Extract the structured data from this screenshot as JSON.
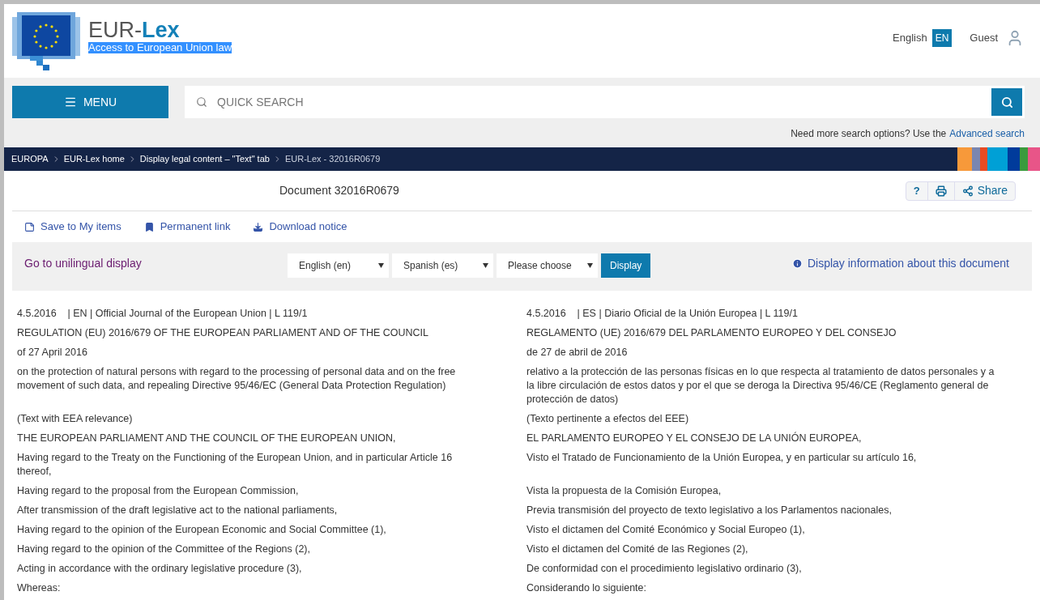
{
  "header": {
    "logo_text": "EUR-",
    "logo_bold": "Lex",
    "tagline": "Access to European Union law",
    "language": "English",
    "language_code": "EN",
    "user": "Guest"
  },
  "search": {
    "menu_label": "MENU",
    "placeholder": "QUICK SEARCH",
    "more_options": "Need more search options? Use the",
    "advanced_link": "Advanced search"
  },
  "breadcrumb": [
    "EUROPA",
    "EUR-Lex home",
    "Display legal content – \"Text\" tab",
    "EUR-Lex - 32016R0679"
  ],
  "document": {
    "title": "Document 32016R0679",
    "tools": [
      {
        "kind": "help",
        "label": "?"
      },
      {
        "kind": "print"
      },
      {
        "kind": "share",
        "label": "Share"
      }
    ]
  },
  "actions": [
    {
      "kind": "save",
      "label": "Save to My items"
    },
    {
      "kind": "bookmark",
      "label": "Permanent link"
    },
    {
      "kind": "download",
      "label": "Download notice"
    }
  ],
  "display_bar": {
    "unilingual_link": "Go to unilingual display",
    "selects": [
      "English (en)",
      "Spanish (es)",
      "Please choose"
    ],
    "display_button": "Display",
    "info_link": "Display information about this document"
  },
  "rows": [
    {
      "en": "4.5.2016    | EN | Official Journal of the European Union | L 119/1",
      "es": "4.5.2016    | ES | Diario Oficial de la Unión Europea | L 119/1"
    },
    {
      "en": "REGULATION (EU) 2016/679 OF THE EUROPEAN PARLIAMENT AND OF THE COUNCIL",
      "es": "REGLAMENTO (UE) 2016/679 DEL PARLAMENTO EUROPEO Y DEL CONSEJO"
    },
    {
      "en": "of 27 April 2016",
      "es": "de 27 de abril de 2016"
    },
    {
      "en": "on the protection of natural persons with regard to the processing of personal data and on the free movement of such data, and repealing Directive 95/46/EC (General Data Protection Regulation)",
      "es": "relativo a la protección de las personas físicas en lo que respecta al tratamiento de datos personales y a la libre circulación de estos datos y por el que se deroga la Directiva 95/46/CE (Reglamento general de protección de datos)"
    },
    {
      "en": "(Text with EEA relevance)",
      "es": "(Texto pertinente a efectos del EEE)"
    },
    {
      "en": "THE EUROPEAN PARLIAMENT AND THE COUNCIL OF THE EUROPEAN UNION,",
      "es": "EL PARLAMENTO EUROPEO Y EL CONSEJO DE LA UNIÓN EUROPEA,"
    },
    {
      "en": "Having regard to the Treaty on the Functioning of the European Union, and in particular Article 16 thereof,",
      "es": "Visto el Tratado de Funcionamiento de la Unión Europea, y en particular su artículo 16,"
    },
    {
      "en": "Having regard to the proposal from the European Commission,",
      "es": "Vista la propuesta de la Comisión Europea,"
    },
    {
      "en": "After transmission of the draft legislative act to the national parliaments,",
      "es": "Previa transmisión del proyecto de texto legislativo a los Parlamentos nacionales,"
    },
    {
      "en": "Having regard to the opinion of the European Economic and Social Committee (1),",
      "es": "Visto el dictamen del Comité Económico y Social Europeo (1),"
    },
    {
      "en": "Having regard to the opinion of the Committee of the Regions (2),",
      "es": "Visto el dictamen del Comité de las Regiones (2),"
    },
    {
      "en": "Acting in accordance with the ordinary legislative procedure (3),",
      "es": "De conformidad con el procedimiento legislativo ordinario (3),"
    },
    {
      "en": "Whereas:",
      "es": "Considerando lo siguiente:"
    }
  ]
}
